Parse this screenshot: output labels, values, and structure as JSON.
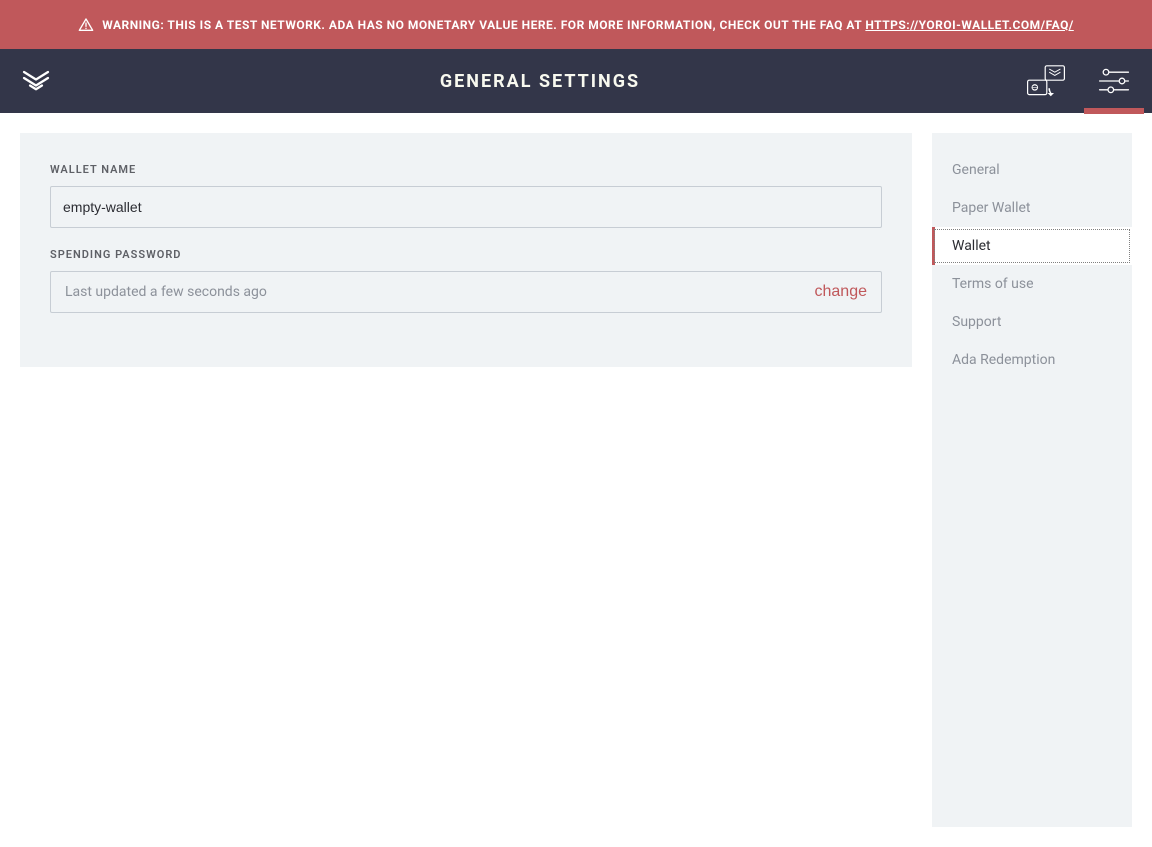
{
  "warning": {
    "prefix": "WARNING:",
    "message": "THIS IS A TEST NETWORK. ADA HAS NO MONETARY VALUE HERE. FOR MORE INFORMATION, CHECK OUT THE FAQ AT",
    "link_text": "HTTPS://YOROI-WALLET.COM/FAQ/"
  },
  "header": {
    "title": "General Settings"
  },
  "form": {
    "wallet_name_label": "WALLET NAME",
    "wallet_name_value": "empty-wallet",
    "spending_password_label": "SPENDING PASSWORD",
    "spending_password_status": "Last updated a few seconds ago",
    "change_label": "change"
  },
  "sidebar": {
    "items": [
      {
        "label": "General",
        "active": false
      },
      {
        "label": "Paper Wallet",
        "active": false
      },
      {
        "label": "Wallet",
        "active": true
      },
      {
        "label": "Terms of use",
        "active": false
      },
      {
        "label": "Support",
        "active": false
      },
      {
        "label": "Ada Redemption",
        "active": false
      }
    ]
  }
}
